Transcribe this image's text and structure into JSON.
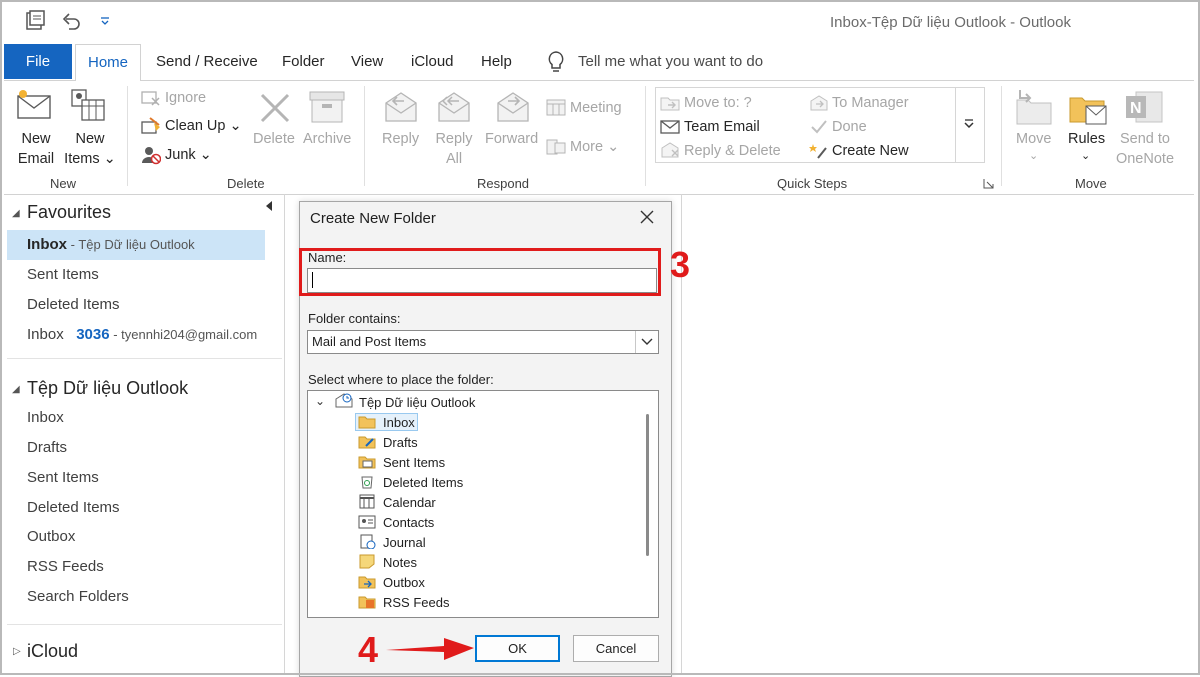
{
  "window": {
    "title": "Inbox-Tệp Dữ liệu Outlook  -  Outlook"
  },
  "tabs": [
    "File",
    "Home",
    "Send / Receive",
    "Folder",
    "View",
    "iCloud",
    "Help"
  ],
  "tell_me": "Tell me what you want to do",
  "ribbon": {
    "new": {
      "new_email_1": "New",
      "new_email_2": "Email",
      "new_items_1": "New",
      "new_items_2": "Items ⌄",
      "group": "New"
    },
    "delete": {
      "ignore": "Ignore",
      "clean_up": "Clean Up ⌄",
      "junk": "Junk ⌄",
      "delete": "Delete",
      "archive": "Archive",
      "group": "Delete"
    },
    "respond": {
      "reply": "Reply",
      "reply_all_1": "Reply",
      "reply_all_2": "All",
      "forward": "Forward",
      "meeting": "Meeting",
      "more": "More ⌄",
      "group": "Respond"
    },
    "quick_steps": {
      "move_to": "Move to: ?",
      "team_email": "Team Email",
      "reply_delete": "Reply & Delete",
      "to_manager": "To Manager",
      "done": "Done",
      "create_new": "Create New",
      "group": "Quick Steps"
    },
    "move": {
      "move": "Move",
      "rules": "Rules",
      "onenote_1": "Send to",
      "onenote_2": "OneNote",
      "group": "Move"
    }
  },
  "folder_pane": {
    "favourites": "Favourites",
    "fav_items": [
      {
        "label": "Inbox",
        "suffix": " - Tệp Dữ liệu Outlook"
      },
      {
        "label": "Sent Items"
      },
      {
        "label": "Deleted Items"
      },
      {
        "label": "Inbox",
        "count": "3036",
        "account": " - tyennhi204@gmail.com"
      }
    ],
    "data_file": "Tệp Dữ liệu Outlook",
    "data_items": [
      "Inbox",
      "Drafts",
      "Sent Items",
      "Deleted Items",
      "Outbox",
      "RSS Feeds",
      "Search Folders"
    ],
    "icloud": "iCloud"
  },
  "dialog": {
    "title": "Create New Folder",
    "name_label": "Name:",
    "name_value": "",
    "contains_label": "Folder contains:",
    "contains_value": "Mail and Post Items",
    "place_label": "Select where to place the folder:",
    "tree_root": "Tệp Dữ liệu Outlook",
    "tree_items": [
      "Inbox",
      "Drafts",
      "Sent Items",
      "Deleted Items",
      "Calendar",
      "Contacts",
      "Journal",
      "Notes",
      "Outbox",
      "RSS Feeds"
    ],
    "ok": "OK",
    "cancel": "Cancel"
  },
  "annotations": {
    "step3": "3",
    "step4": "4"
  },
  "colors": {
    "accent": "#1565c0",
    "highlight": "#e01b1b",
    "selection": "#cce4f7"
  }
}
